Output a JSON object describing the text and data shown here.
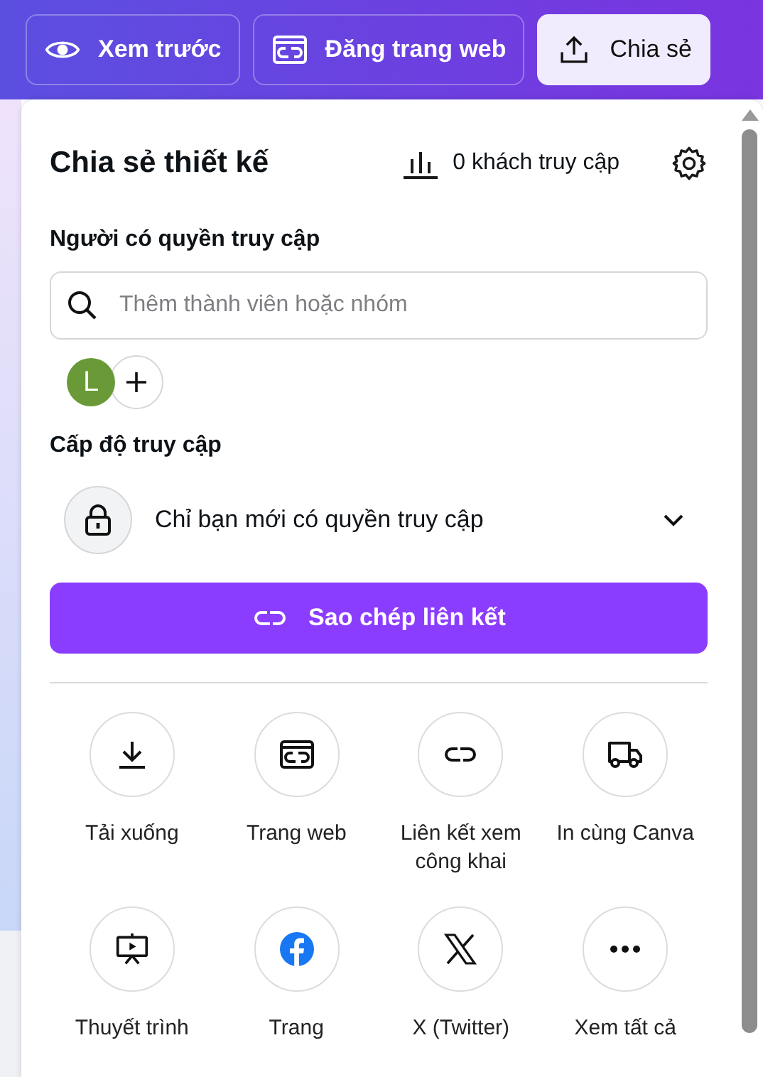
{
  "toolbar": {
    "buttons": [
      {
        "label": "Xem trước",
        "kind": "preview",
        "selected": false
      },
      {
        "label": "Đăng trang web",
        "kind": "publish",
        "selected": false
      },
      {
        "label": "Chia sẻ",
        "kind": "share",
        "selected": true
      }
    ]
  },
  "share_panel": {
    "title": "Chia sẻ thiết kế",
    "visitors": "0 khách truy cập",
    "people_heading": "Người có quyền truy cập",
    "search": {
      "placeholder": "Thêm thành viên hoặc nhóm"
    },
    "members": [
      {
        "initial": "L",
        "color": "#6a9a37"
      }
    ],
    "access_heading": "Cấp độ truy cập",
    "access_level": "Chỉ bạn mới có quyền truy cập",
    "copy_link_button": "Sao chép liên kết",
    "options": [
      {
        "label": "Tải xuống",
        "kind": "download"
      },
      {
        "label": "Trang web",
        "kind": "web"
      },
      {
        "label": "Liên kết xem công khai",
        "kind": "link"
      },
      {
        "label": "In cùng Canva",
        "kind": "truck"
      },
      {
        "label": "Thuyết trình",
        "kind": "present"
      },
      {
        "label": "Trang",
        "kind": "facebook"
      },
      {
        "label": "X (Twitter)",
        "kind": "x"
      },
      {
        "label": "Xem tất cả",
        "kind": "more"
      }
    ]
  }
}
